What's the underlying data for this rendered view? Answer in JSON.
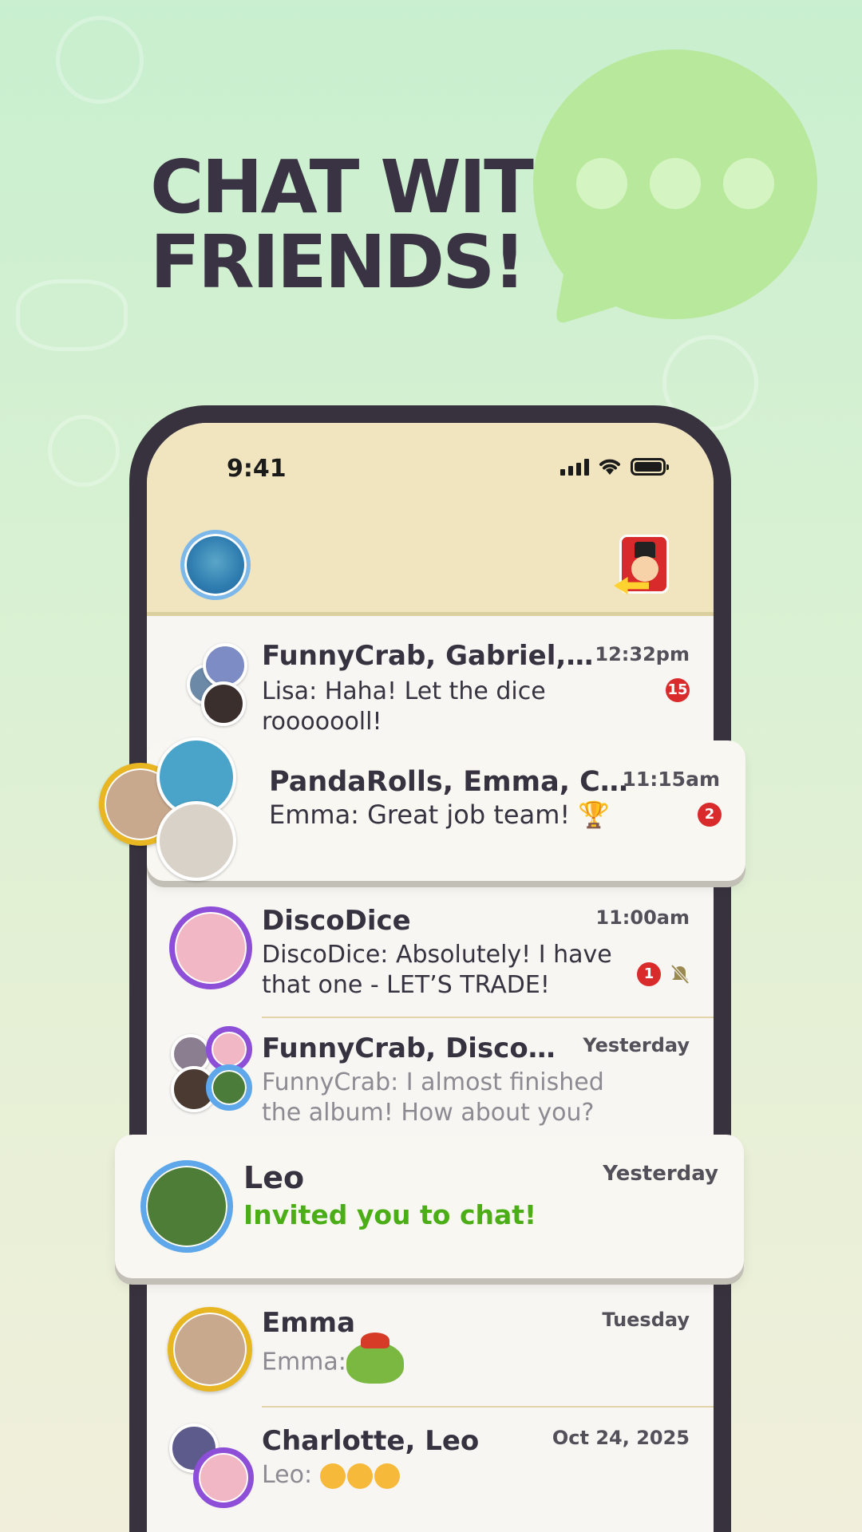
{
  "headline": {
    "line1": "CHAT WITH",
    "line2": "FRIENDS!"
  },
  "status_bar": {
    "time": "9:41"
  },
  "chats": [
    {
      "name": "FunnyCrab, Gabriel, Lisa",
      "message": "Lisa: Haha! Let the dice rooooooll!",
      "time": "12:32pm",
      "unread": "15"
    },
    {
      "name": "PandaRolls, Emma, Charl…",
      "message": "Emma: Great job team! 🏆",
      "time": "11:15am",
      "unread": "2"
    },
    {
      "name": "DiscoDice",
      "message": "DiscoDice: Absolutely! I have that one - LET’S TRADE!",
      "time": "11:00am",
      "unread": "1",
      "muted": true
    },
    {
      "name": "FunnyCrab, DiscoDice,…",
      "message": "FunnyCrab: I almost finished the album! How about you?",
      "time": "Yesterday"
    },
    {
      "name": "Leo",
      "message": "Invited you to chat!",
      "time": "Yesterday"
    },
    {
      "name": "Emma",
      "message": "Emma:",
      "time": "Tuesday"
    },
    {
      "name": "Charlotte, Leo",
      "message": "Leo:",
      "time": "Oct 24, 2025"
    }
  ],
  "colors": {
    "accent_green": "#4cae16",
    "badge_red": "#d92b2b",
    "topbar": "#f1e5bf",
    "phone_frame": "#38323f"
  },
  "icons": [
    "signal-icon",
    "wifi-icon",
    "battery-icon",
    "mute-bell-icon",
    "chat-bubble-icon",
    "trophy-emoji"
  ]
}
